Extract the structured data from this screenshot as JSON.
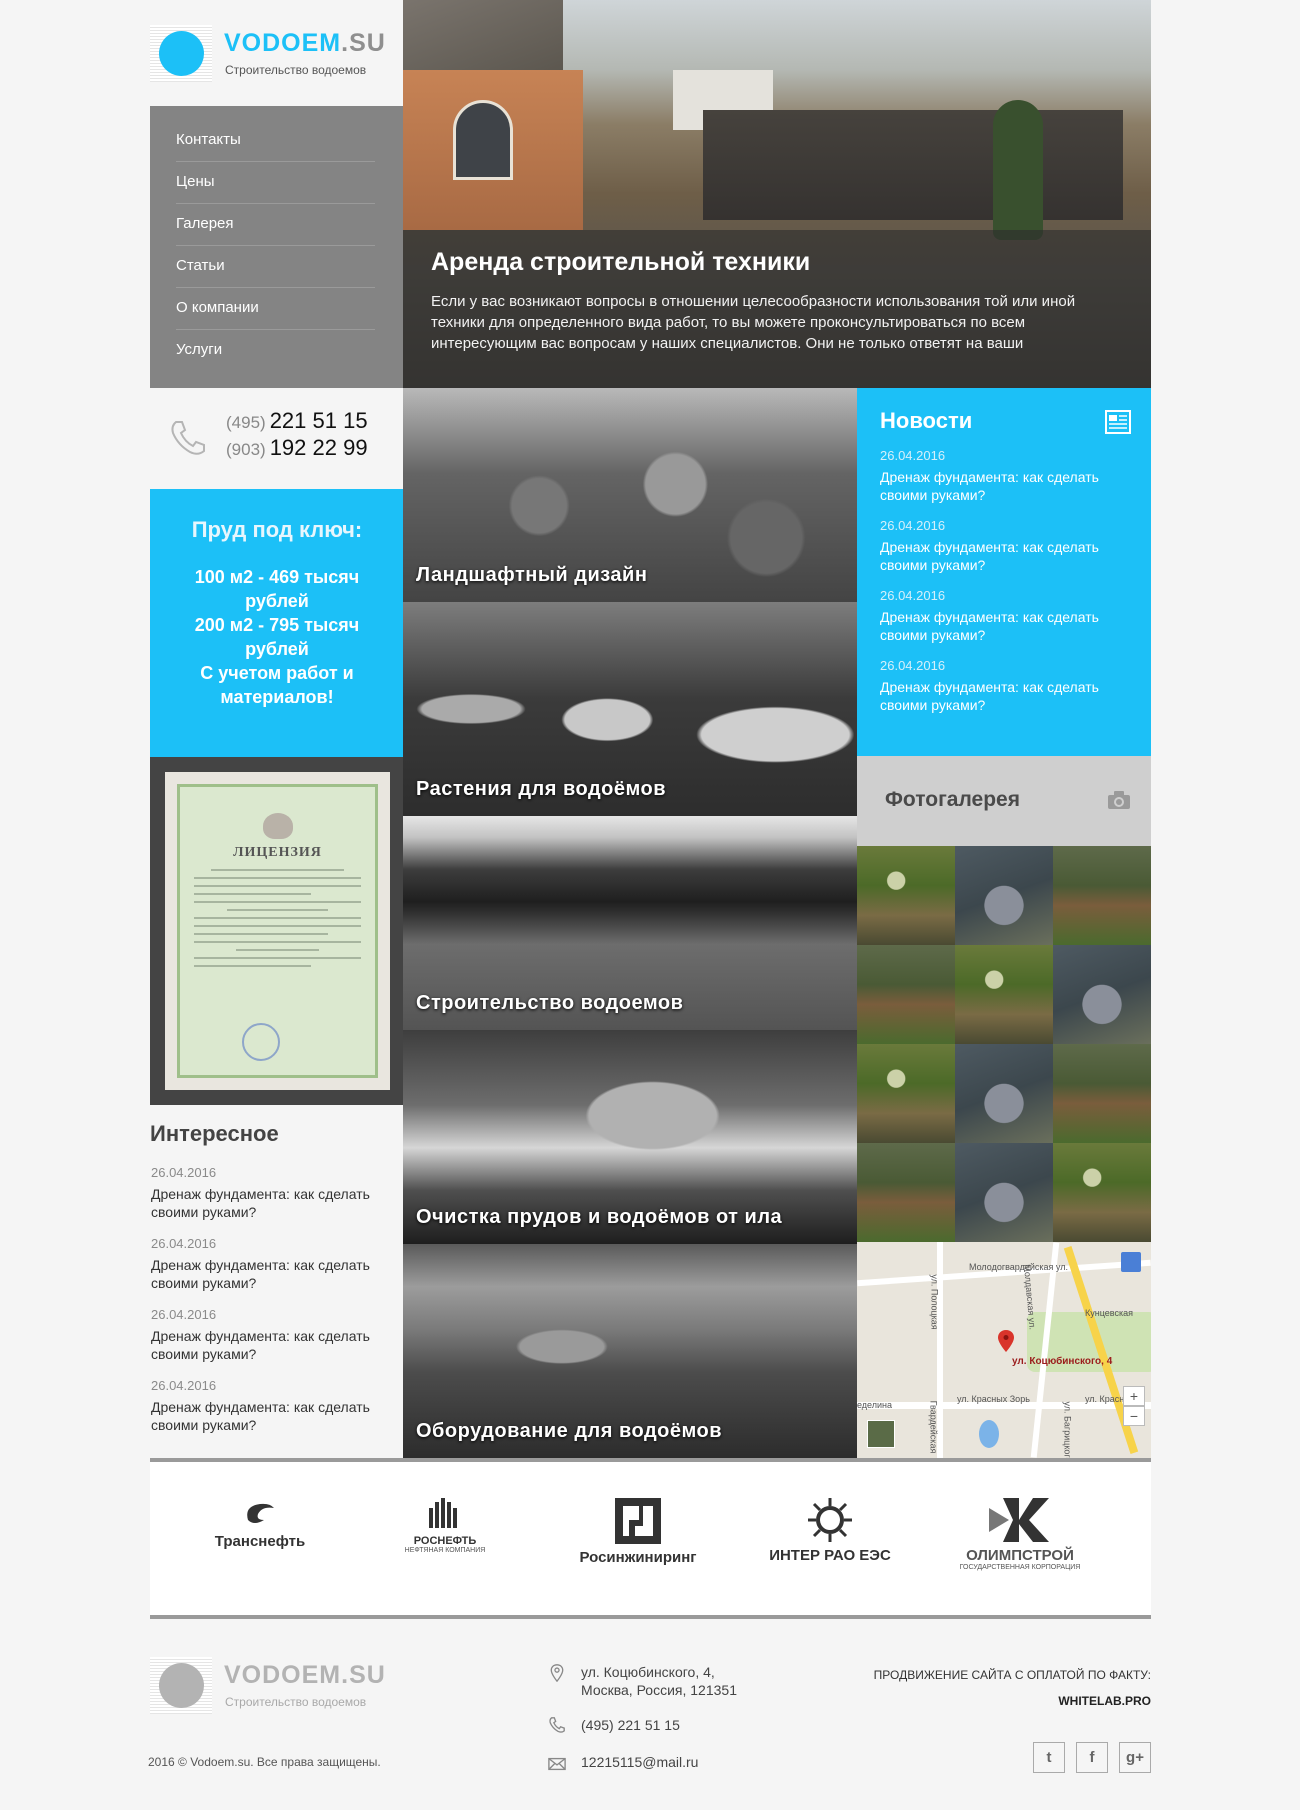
{
  "brand": {
    "name": "VODOEM",
    "tld": ".SU",
    "tagline": "Строительство водоемов",
    "accent": "#1cc0f7"
  },
  "nav": {
    "items": [
      {
        "label": "Контакты"
      },
      {
        "label": "Цены"
      },
      {
        "label": "Галерея"
      },
      {
        "label": "Статьи"
      },
      {
        "label": "О компании"
      },
      {
        "label": "Услуги"
      }
    ]
  },
  "phones": [
    {
      "code": "(495)",
      "number": "221 51 15"
    },
    {
      "code": "(903)",
      "number": "192 22 99"
    }
  ],
  "promo": {
    "title": "Пруд под ключ:",
    "lines": [
      "100 м2 - 469 тысяч рублей",
      "200 м2 - 795 тысяч рублей",
      "С учетом работ и материалов!"
    ]
  },
  "license": {
    "title": "ЛИЦЕНЗИЯ"
  },
  "interesting": {
    "title": "Интересное",
    "items": [
      {
        "date": "26.04.2016",
        "title": "Дренаж фундамента: как сделать своими руками?"
      },
      {
        "date": "26.04.2016",
        "title": "Дренаж фундамента: как сделать своими руками?"
      },
      {
        "date": "26.04.2016",
        "title": "Дренаж фундамента: как сделать своими руками?"
      },
      {
        "date": "26.04.2016",
        "title": "Дренаж фундамента: как сделать своими руками?"
      }
    ]
  },
  "hero": {
    "title": "Аренда строительной техники",
    "text": "Если у вас возникают вопросы в отношении целесообразности использования той или иной техники для определенного вида работ, то вы можете проконсультироваться по всем интересующим вас вопросам у наших специалистов. Они не только ответят на ваши"
  },
  "services": [
    {
      "label": "Ландшафтный дизайн"
    },
    {
      "label": "Растения для водоёмов"
    },
    {
      "label": "Строительство водоемов"
    },
    {
      "label": "Очистка прудов и водоёмов от ила"
    },
    {
      "label": "Оборудование для водоёмов"
    }
  ],
  "news": {
    "title": "Новости",
    "icon": "newspaper-icon",
    "items": [
      {
        "date": "26.04.2016",
        "title": "Дренаж фундамента: как сделать своими руками?"
      },
      {
        "date": "26.04.2016",
        "title": "Дренаж фундамента: как сделать своими руками?"
      },
      {
        "date": "26.04.2016",
        "title": "Дренаж фундамента: как сделать своими руками?"
      },
      {
        "date": "26.04.2016",
        "title": "Дренаж фундамента: как сделать своими руками?"
      }
    ]
  },
  "gallery": {
    "title": "Фотогалерея",
    "icon": "camera-icon"
  },
  "map": {
    "streets": [
      "Молодогвардейская ул.",
      "ул. Полоцкая",
      "Молдавская ул.",
      "Кунцевская",
      "ул. Красных Зорь",
      "ул. Красных",
      "еделина",
      "Гвардейская",
      "ул. Багрицкого"
    ],
    "marker": "ул. Коцюбинского, 4",
    "zoom_in": "+",
    "zoom_out": "−"
  },
  "partners": [
    {
      "name": "Транснефть",
      "sub": ""
    },
    {
      "name": "РОСНЕФТЬ",
      "sub": "НЕФТЯНАЯ КОМПАНИЯ"
    },
    {
      "name": "Росинжиниринг",
      "sub": ""
    },
    {
      "name": "ИНТЕР РАО ЕЭС",
      "sub": ""
    },
    {
      "name": "ОЛИМПСТРОЙ",
      "sub": "ГОСУДАРСТВЕННАЯ КОРПОРАЦИЯ"
    }
  ],
  "footer": {
    "address_line1": "ул. Коцюбинского, 4,",
    "address_line2": "Москва, Россия, 121351",
    "phone": "(495) 221 51 15",
    "email": "12215115@mail.ru",
    "copyright": "2016 © Vodoem.su.  Все права защищены.",
    "promo_text": "ПРОДВИЖЕНИЕ САЙТА С ОПЛАТОЙ ПО ФАКТУ:",
    "promo_link": "WHITELAB.PRO",
    "social": [
      {
        "icon": "twitter-icon",
        "glyph": "t"
      },
      {
        "icon": "facebook-icon",
        "glyph": "f"
      },
      {
        "icon": "google-plus-icon",
        "glyph": "g+"
      }
    ]
  }
}
